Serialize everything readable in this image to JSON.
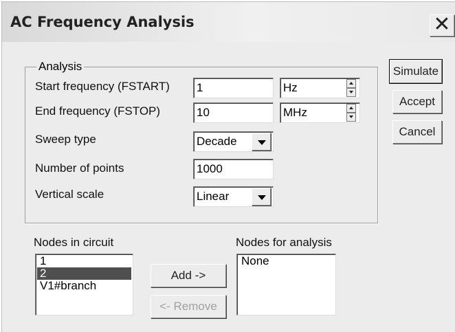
{
  "window": {
    "title": "AC Frequency Analysis",
    "close_glyph": "✕"
  },
  "buttons": {
    "simulate": "Simulate",
    "accept": "Accept",
    "cancel": "Cancel",
    "add": "Add ->",
    "remove": "<- Remove"
  },
  "analysis": {
    "legend": "Analysis",
    "start_label": "Start frequency (FSTART)",
    "start_value": "1",
    "start_unit": "Hz",
    "end_label": "End frequency (FSTOP)",
    "end_value": "10",
    "end_unit": "MHz",
    "sweep_label": "Sweep type",
    "sweep_value": "Decade",
    "points_label": "Number of points",
    "points_value": "1000",
    "scale_label": "Vertical scale",
    "scale_value": "Linear"
  },
  "nodes": {
    "circuit_label": "Nodes in circuit",
    "circuit_items": [
      "1",
      "2",
      "V1#branch"
    ],
    "selected_index": 1,
    "analysis_label": "Nodes for analysis",
    "analysis_items": [
      "None"
    ]
  }
}
